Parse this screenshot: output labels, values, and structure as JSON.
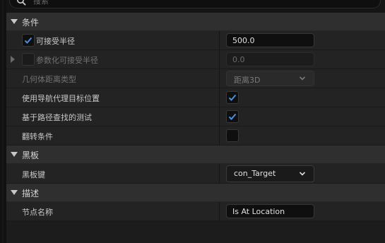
{
  "search": {
    "placeholder": "搜索"
  },
  "sections": {
    "conditions": {
      "label": "条件",
      "rows": {
        "accept_radius": {
          "label": "可接受半径",
          "checked": true,
          "value": "500.0"
        },
        "param_accept_radius": {
          "label": "参数化可接受半径",
          "checked": false,
          "value": "0.0"
        },
        "geometry_distance_type": {
          "label": "几何体距离类型",
          "value": "距离3D"
        },
        "use_nav_agent_goal_location": {
          "label": "使用导航代理目标位置",
          "checked": true
        },
        "path_finding_based_test": {
          "label": "基于路径查找的测试",
          "checked": true
        },
        "inverse_condition": {
          "label": "翻转条件",
          "checked": false
        }
      }
    },
    "blackboard": {
      "label": "黑板",
      "rows": {
        "blackboard_key": {
          "label": "黑板键",
          "value": "con_Target"
        }
      }
    },
    "description": {
      "label": "描述",
      "rows": {
        "node_name": {
          "label": "节点名称",
          "value": "Is At Location"
        }
      }
    }
  },
  "colors": {
    "accent_check": "#4a8ee0",
    "category_bg": "#2f2f2f",
    "row_bg": "#232323",
    "field_bg": "#0f0f0f"
  },
  "icons": [
    "search-icon",
    "collapse-arrow-icon",
    "expand-arrow-icon",
    "checkmark-icon",
    "chevron-down-icon"
  ]
}
